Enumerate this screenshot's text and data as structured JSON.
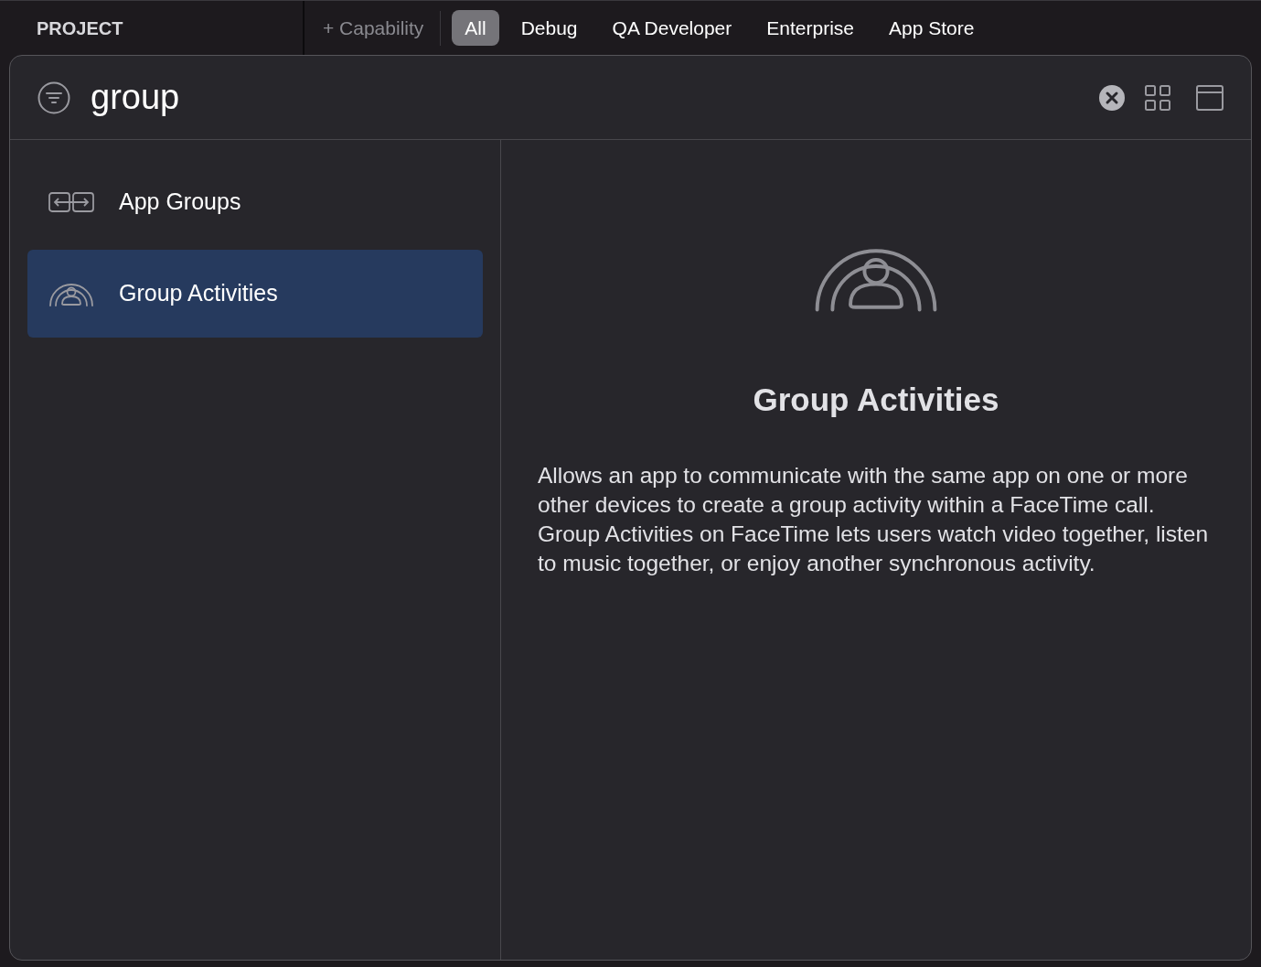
{
  "top_bar": {
    "section": "PROJECT",
    "add_button": "+ Capability",
    "tabs": [
      {
        "label": "All",
        "selected": true
      },
      {
        "label": "Debug",
        "selected": false
      },
      {
        "label": "QA Developer",
        "selected": false
      },
      {
        "label": "Enterprise",
        "selected": false
      },
      {
        "label": "App Store",
        "selected": false
      }
    ]
  },
  "search": {
    "value": "group"
  },
  "capabilities": [
    {
      "name": "App Groups",
      "kind": "groups",
      "selected": false
    },
    {
      "name": "Group Activities",
      "kind": "activities",
      "selected": true
    }
  ],
  "detail": {
    "kind": "activities",
    "title": "Group Activities",
    "description": "Allows an app to communicate with the same app on one or more other devices to create a group activity within a FaceTime call. Group Activities on FaceTime lets users watch video together, listen to music together, or enjoy another synchronous activity."
  }
}
